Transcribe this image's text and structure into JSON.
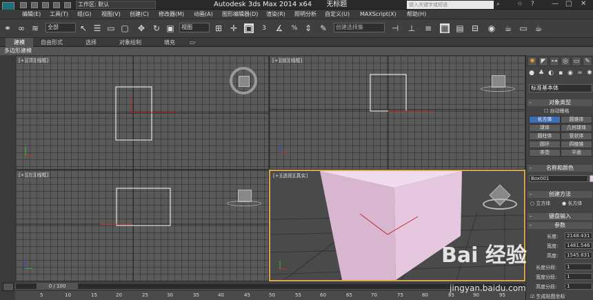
{
  "titlebar": {
    "workspace_label": "工作区: 默认",
    "app_title": "Autodesk 3ds Max  2014 x64",
    "doc_title": "无标题",
    "search_placeholder": "键入关键字或短语"
  },
  "menu": [
    "编辑(E)",
    "工具(T)",
    "组(G)",
    "视图(V)",
    "创建(C)",
    "修改器(M)",
    "动画(A)",
    "图形编辑器(D)",
    "渲染(R)",
    "照明分析",
    "自定义(U)",
    "MAXScript(X)",
    "帮助(H)"
  ],
  "toolbar": {
    "filter_value": "全部",
    "ref_coord_value": "视图",
    "selection_set_placeholder": "创建选择集",
    "num_snap": "3",
    "angle_snap": "2.5",
    "percent_snap": "%"
  },
  "ribbon": {
    "tabs": [
      "建模",
      "自由形式",
      "选择",
      "对象绘制",
      "填充"
    ],
    "active_tab": "建模",
    "sub_label": "多边形建模"
  },
  "viewports": {
    "top": "[+][顶][线框]",
    "front": "[+][前][线框]",
    "left": "[+][左][线框]",
    "persp": "[+][透视][真实]"
  },
  "command_panel": {
    "category_dropdown": "标准基本体",
    "object_type_title": "对象类型",
    "auto_grid_label": "自动栅格",
    "buttons": [
      "长方体",
      "圆锥体",
      "球体",
      "几何球体",
      "圆柱体",
      "管状体",
      "圆环",
      "四棱锥",
      "茶壶",
      "平面"
    ],
    "selected_button": "长方体",
    "name_color_title": "名称和颜色",
    "object_name": "Box001",
    "object_color": "#e8c8e8",
    "creation_method_title": "创建方法",
    "creation_options": [
      "立方体",
      "长方体"
    ],
    "keyboard_entry_title": "键盘输入",
    "params_title": "参数",
    "length_label": "长度:",
    "length_value": "2148.431",
    "width_label": "宽度:",
    "width_value": "1481.546",
    "height_label": "高度:",
    "height_value": "1545.831",
    "seg_l_label": "长度分段:",
    "seg_l": "1",
    "seg_w_label": "宽度分段:",
    "seg_w": "1",
    "seg_h_label": "高度分段:",
    "seg_h": "1",
    "gen_uv_label": "生成贴图坐标"
  },
  "timeline": {
    "frame_label": "0 / 100",
    "ticks": [
      "5",
      "10",
      "15",
      "20",
      "25",
      "30",
      "35",
      "40",
      "45",
      "50",
      "55",
      "60",
      "65",
      "70",
      "75",
      "80",
      "85",
      "90",
      "95"
    ]
  },
  "watermark": {
    "brand": "Bai  经验",
    "url": "jingyan.baidu.com"
  }
}
